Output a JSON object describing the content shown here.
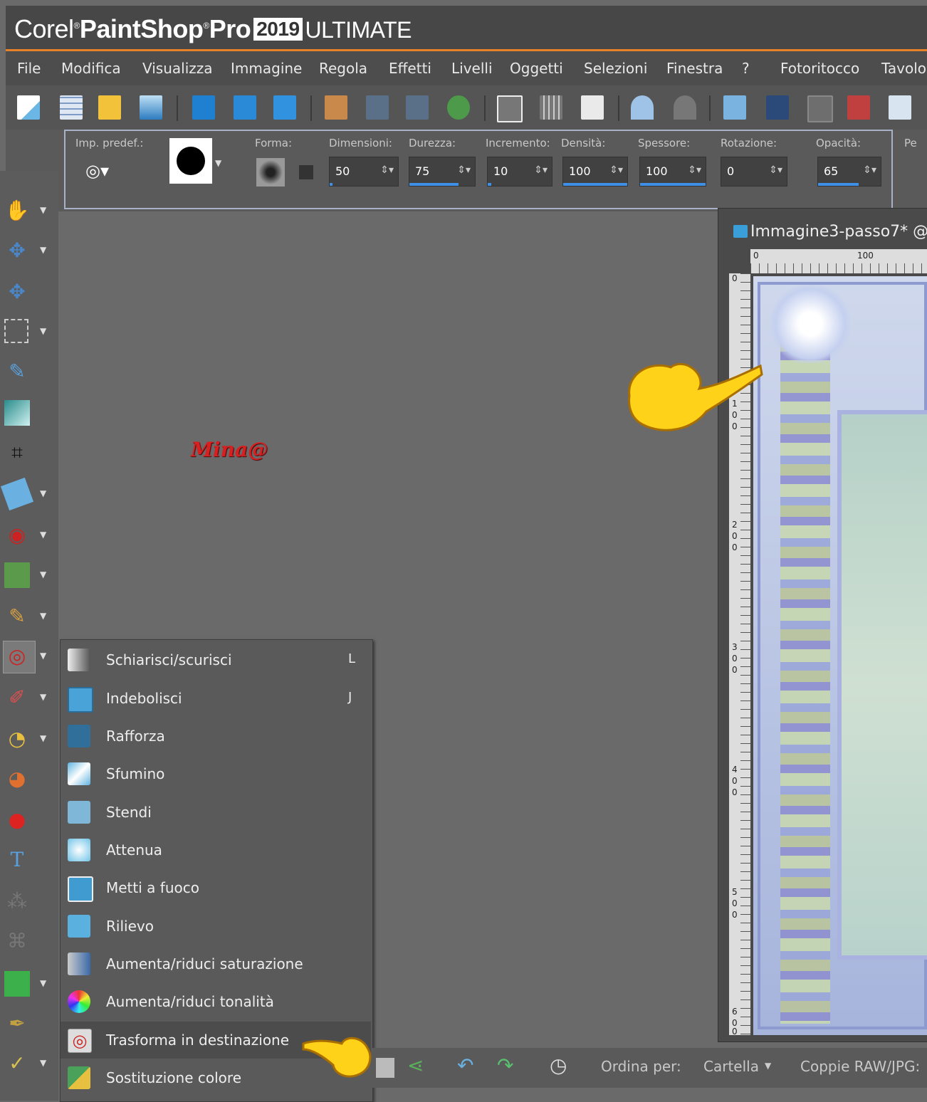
{
  "app": {
    "brand_corel": "Corel",
    "brand_psp": "PaintShop",
    "brand_pro": "Pro",
    "version": "2019",
    "edition": "ULTIMATE"
  },
  "menu": [
    "File",
    "Modifica",
    "Visualizza",
    "Immagine",
    "Regola",
    "Effetti",
    "Livelli",
    "Oggetti",
    "Selezioni",
    "Finestra",
    "?",
    "Fotoritocco",
    "Tavolo"
  ],
  "toolbar_icons": [
    "new-icon",
    "grid-icon",
    "open-folder-icon",
    "scan-icon",
    "save-icon",
    "save-as-icon",
    "save-copy-icon",
    "archive-icon",
    "export-jpg-icon",
    "export-png-icon",
    "share-icon",
    "ruler-icon",
    "grid-toggle-icon",
    "print-icon",
    "undo-icon",
    "redo-icon",
    "resize-icon",
    "fit-icon",
    "crop-icon",
    "histogram-icon",
    "table-icon"
  ],
  "options": {
    "preset_label": "Imp. predef.:",
    "shape_label": "Forma:",
    "size_label": "Dimensioni:",
    "size_value": "50",
    "hardness_label": "Durezza:",
    "hardness_value": "75",
    "step_label": "Incremento:",
    "step_value": "10",
    "density_label": "Densità:",
    "density_value": "100",
    "thickness_label": "Spessore:",
    "thickness_value": "100",
    "rotation_label": "Rotazione:",
    "rotation_value": "0",
    "opacity_label": "Opacità:",
    "opacity_value": "65",
    "extra_label": "Pe"
  },
  "watermark": "Mina@",
  "document": {
    "title": "Immagine3-passo7* @",
    "ruler_top": [
      "0",
      "100"
    ],
    "ruler_left": [
      "0",
      "1",
      "0",
      "0",
      "2",
      "0",
      "0",
      "3",
      "0",
      "0",
      "4",
      "0",
      "0",
      "5",
      "0",
      "0",
      "6",
      "0",
      "0"
    ]
  },
  "submenu": [
    {
      "label": "Schiarisci/scurisci",
      "key": "L",
      "icon": "dodge-burn-icon",
      "color": "#c8c8c8"
    },
    {
      "label": "Indebolisci",
      "key": "J",
      "icon": "soften-icon",
      "color": "#4aa3d8"
    },
    {
      "label": "Rafforza",
      "key": "",
      "icon": "sharpen-icon",
      "color": "#2f6f9a"
    },
    {
      "label": "Sfumino",
      "key": "",
      "icon": "smudge-icon",
      "color": "#5fb3e0"
    },
    {
      "label": "Stendi",
      "key": "",
      "icon": "push-icon",
      "color": "#7fb7d8"
    },
    {
      "label": "Attenua",
      "key": "",
      "icon": "lighten-icon",
      "color": "#6fc3e8"
    },
    {
      "label": "Metti a fuoco",
      "key": "",
      "icon": "emboss-icon",
      "color": "#3f9bd0"
    },
    {
      "label": "Rilievo",
      "key": "",
      "icon": "relief-icon",
      "color": "#5ab0df"
    },
    {
      "label": "Aumenta/riduci saturazione",
      "key": "",
      "icon": "saturation-icon",
      "color": "#6e86a8"
    },
    {
      "label": "Aumenta/riduci tonalità",
      "key": "",
      "icon": "hue-icon",
      "color": "#e04848"
    },
    {
      "label": "Trasforma in destinazione",
      "key": "",
      "icon": "target-icon",
      "color": "#d63a3a"
    },
    {
      "label": "Sostituzione colore",
      "key": "",
      "icon": "color-replace-icon",
      "color": "#4aa15a"
    }
  ],
  "bottombar": {
    "sort_label": "Ordina per:",
    "sort_value": "Cartella",
    "raw_label": "Coppie RAW/JPG:"
  },
  "colors": {
    "accent_orange": "#e8822a",
    "slider_blue": "#3e8fe6",
    "hand_yellow": "#ffd21a"
  }
}
